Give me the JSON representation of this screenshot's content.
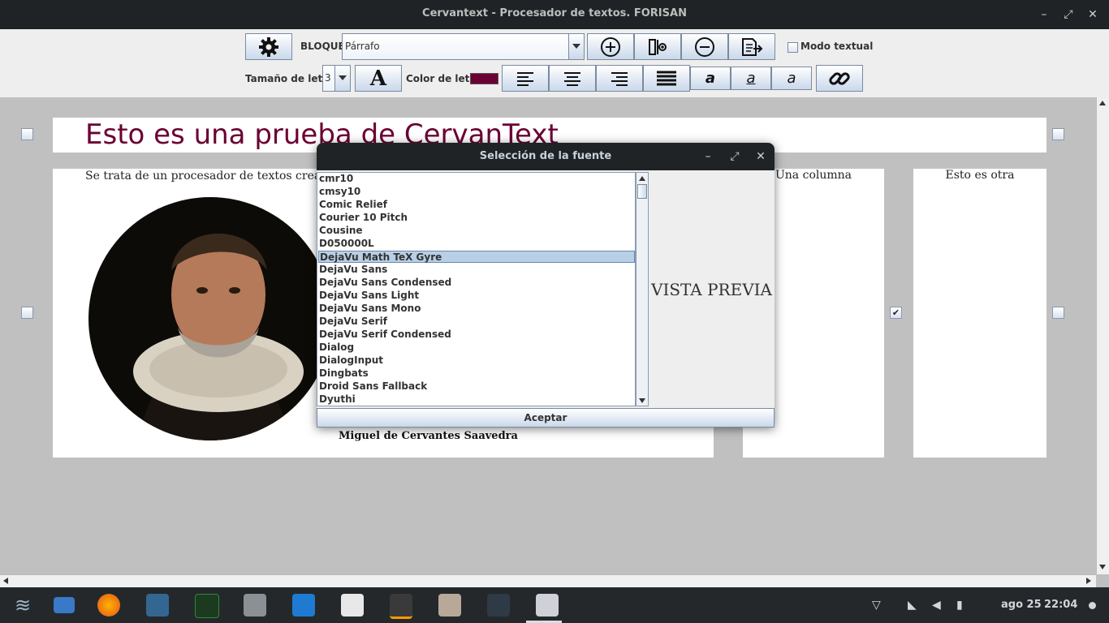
{
  "window": {
    "title": "Cervantext - Procesador de textos. FORISAN",
    "minimize_icon": "–",
    "maximize_icon": "⤢",
    "close_icon": "✕"
  },
  "toolbar": {
    "block_label": "BLOQUE",
    "block_value": "Párrafo",
    "textual_mode_label": "Modo textual",
    "font_size_label": "Tamaño de letra",
    "font_size_value": "3",
    "font_color_label": "Color de letra",
    "font_color": "#6b0033",
    "font_button_glyph": "A",
    "style_a1": "a",
    "style_a2": "a",
    "style_a3": "a"
  },
  "document": {
    "heading": "Esto es una prueba de CervanText",
    "heading_color": "#6b0033",
    "col1_text": "Se trata de un procesador de textos crea",
    "caption": "Miguel de Cervantes Saavedra",
    "col2_text": "Una columna",
    "col3_text": "Esto es otra",
    "checked_mark": "✔"
  },
  "dialog": {
    "title": "Selección de la fuente",
    "fonts": [
      "cmr10",
      "cmsy10",
      "Comic Relief",
      "Courier 10 Pitch",
      "Cousine",
      "D050000L",
      "DejaVu Math TeX Gyre",
      "DejaVu Sans",
      "DejaVu Sans Condensed",
      "DejaVu Sans Light",
      "DejaVu Sans Mono",
      "DejaVu Serif",
      "DejaVu Serif Condensed",
      "Dialog",
      "DialogInput",
      "Dingbats",
      "Droid Sans Fallback",
      "Dyuthi"
    ],
    "selected_font": "DejaVu Math TeX Gyre",
    "preview_text": "VISTA PREVIA",
    "accept_label": "Aceptar"
  },
  "taskbar": {
    "date": "ago 25",
    "time": "22:04"
  }
}
